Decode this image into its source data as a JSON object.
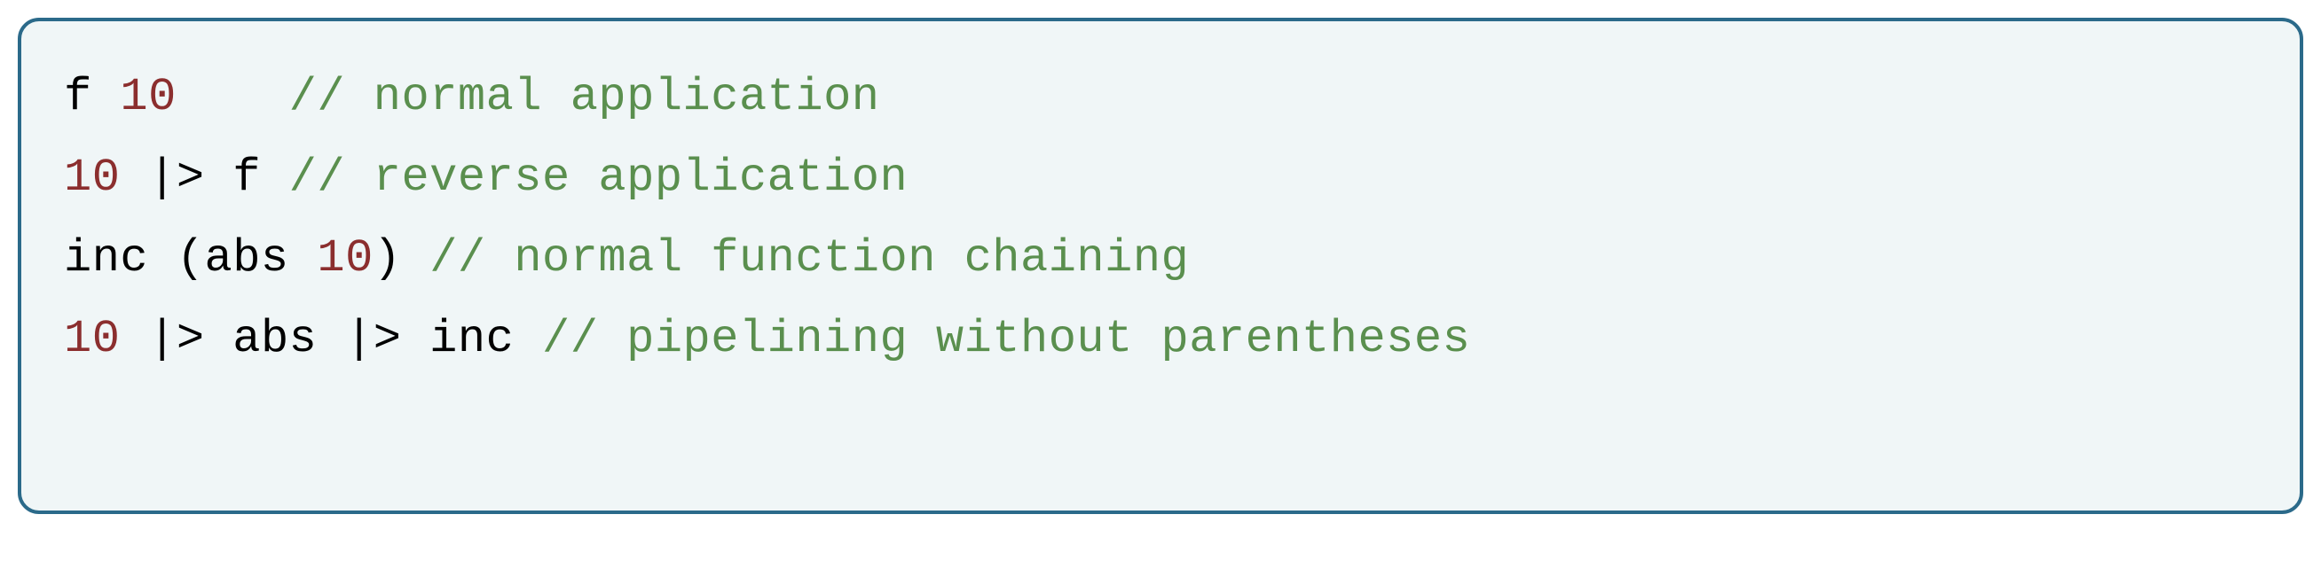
{
  "code": {
    "lines": [
      {
        "tokens": [
          {
            "text": "f ",
            "cls": "tok-ident"
          },
          {
            "text": "10",
            "cls": "tok-num"
          },
          {
            "text": "    ",
            "cls": "tok-ident"
          },
          {
            "text": "// normal application",
            "cls": "tok-comment"
          }
        ]
      },
      {
        "tokens": [
          {
            "text": "10",
            "cls": "tok-num"
          },
          {
            "text": " |> f ",
            "cls": "tok-op"
          },
          {
            "text": "// reverse application",
            "cls": "tok-comment"
          }
        ]
      },
      {
        "tokens": [
          {
            "text": "inc (abs ",
            "cls": "tok-ident"
          },
          {
            "text": "10",
            "cls": "tok-num"
          },
          {
            "text": ") ",
            "cls": "tok-ident"
          },
          {
            "text": "// normal function chaining",
            "cls": "tok-comment"
          }
        ]
      },
      {
        "tokens": [
          {
            "text": "10",
            "cls": "tok-num"
          },
          {
            "text": " |> abs |> inc ",
            "cls": "tok-op"
          },
          {
            "text": "// pipelining without parentheses",
            "cls": "tok-comment"
          }
        ]
      }
    ]
  }
}
